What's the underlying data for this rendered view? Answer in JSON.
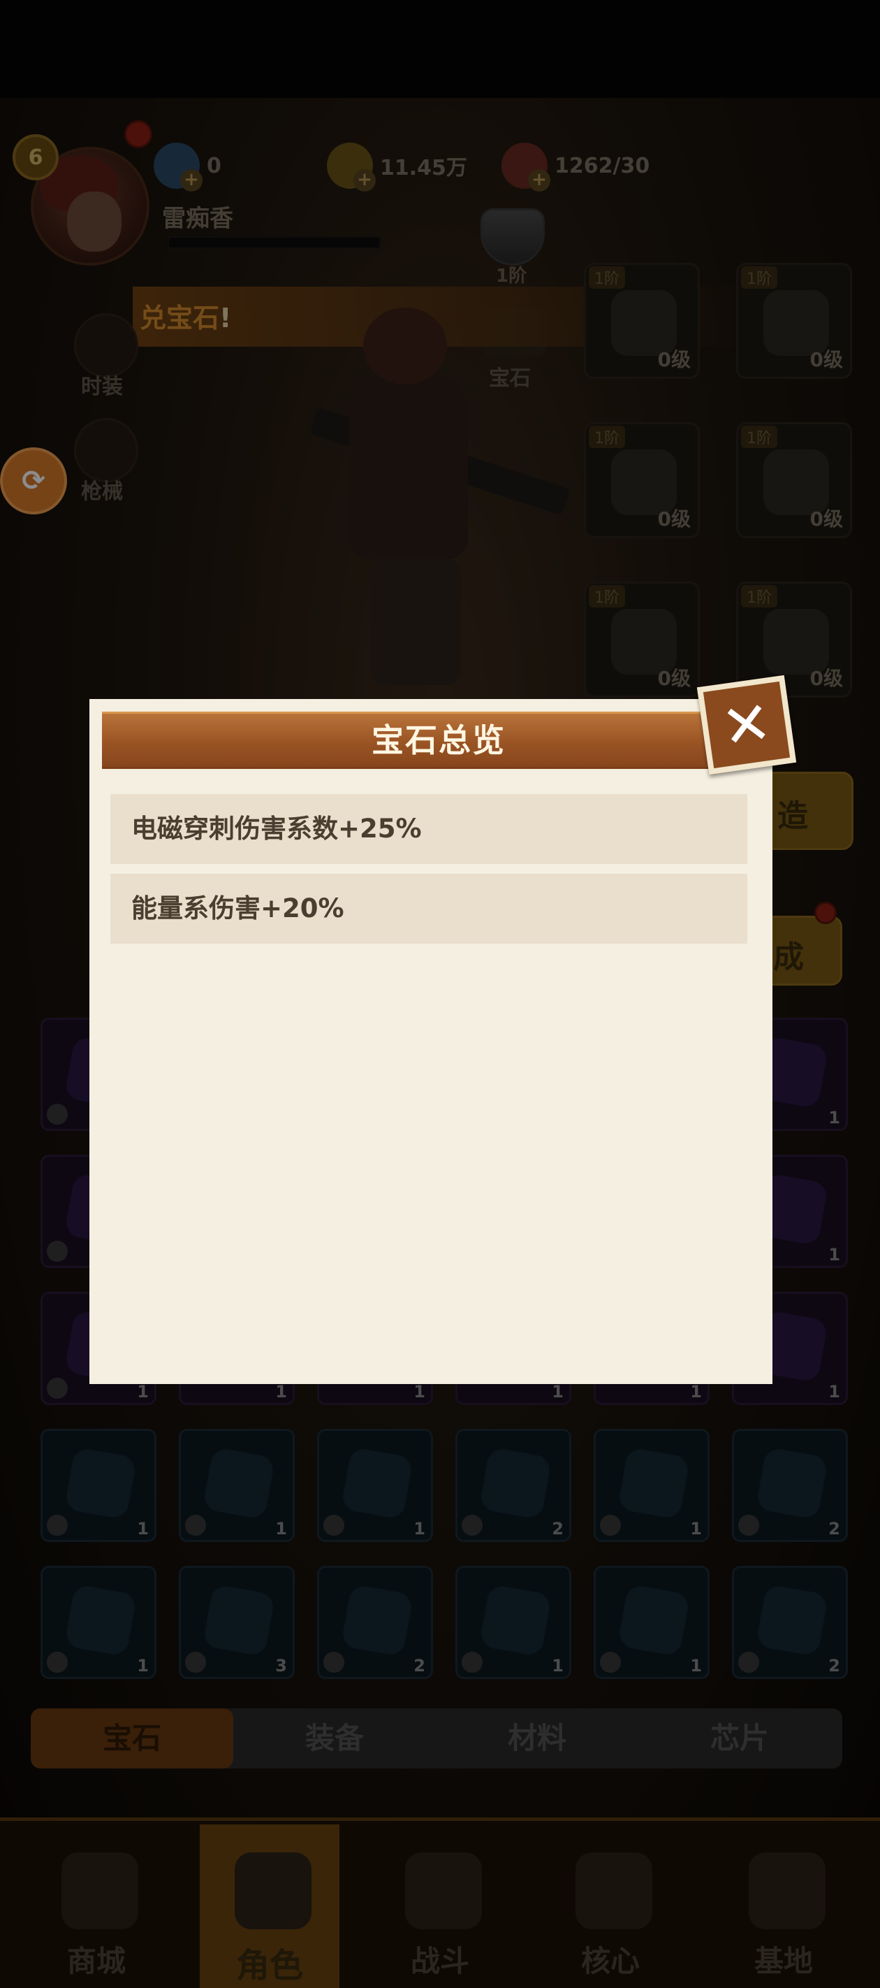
{
  "header": {
    "level": "6",
    "player_name": "雷痴香",
    "diamonds": "0",
    "coins": "11.45万",
    "stamina": "1262/30",
    "shield_label": "1阶"
  },
  "banner": {
    "text": "兑宝石",
    "bang": "!"
  },
  "side_menu": {
    "costume": "时装",
    "weapon": "枪械"
  },
  "gem_tab_label": "宝石",
  "equipment": {
    "slots": [
      {
        "tier": "1阶",
        "level": "0级"
      },
      {
        "tier": "1阶",
        "level": "0级"
      },
      {
        "tier": "1阶",
        "level": "0级"
      },
      {
        "tier": "1阶",
        "level": "0级"
      },
      {
        "tier": "1阶",
        "level": "0级"
      },
      {
        "tier": "1阶",
        "level": "0级"
      }
    ]
  },
  "buttons": {
    "forge": "造",
    "synthesize": "成"
  },
  "gem_grid": {
    "row4_counts": [
      "1",
      "1",
      "1",
      "2",
      "1",
      "2"
    ],
    "row5_counts": [
      "1",
      "3",
      "2",
      "1",
      "1",
      "2"
    ],
    "purple_right_counts": [
      "1",
      "1",
      "1"
    ],
    "partial_counts": [
      "1",
      "1",
      "1",
      "1",
      "1"
    ]
  },
  "subtabs": [
    "宝石",
    "装备",
    "材料",
    "芯片"
  ],
  "bottom_nav": [
    "商城",
    "角色",
    "战斗",
    "核心",
    "基地"
  ],
  "modal": {
    "title": "宝石总览",
    "stats": [
      "电磁穿刺伤害系数+25%",
      "能量系伤害+20%"
    ]
  },
  "colors": {
    "modal_bg": "#f5efe1",
    "title_bar": "#9a5424",
    "stat_row_bg": "#e9dfcc",
    "stat_text": "#4a3e30"
  },
  "icons": {
    "close": "close-icon",
    "diamond": "diamond-icon",
    "coin": "coin-icon",
    "stamina": "meat-icon"
  }
}
